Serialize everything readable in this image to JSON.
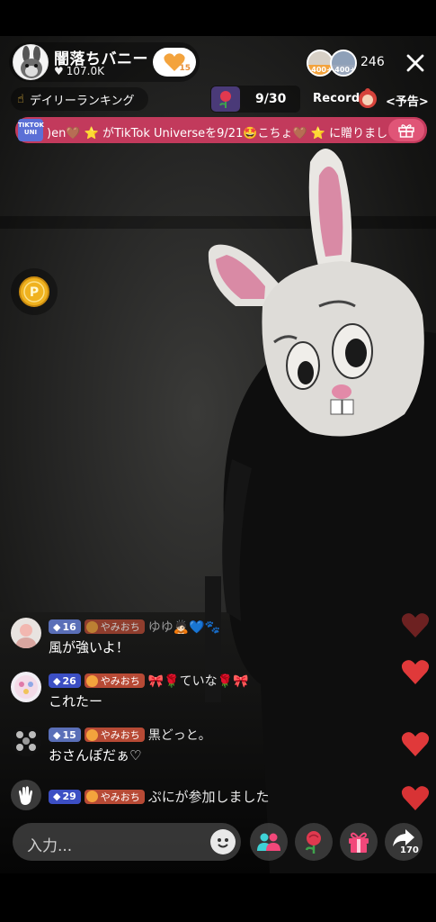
{
  "host": {
    "name": "闇落ちバニー",
    "likes": "107.0K",
    "follow_badge_count": "15"
  },
  "viewers": {
    "badge_1": "400+",
    "badge_2": "400+",
    "count": "246"
  },
  "ranking": {
    "label": "デイリーランキング"
  },
  "goal": {
    "progress": "9/30",
    "record_label": "Record",
    "preview_label": "<予告>"
  },
  "banner": {
    "logo_text": "TIKTOK UNI",
    "text": ")en🤎 ⭐ がTikTok Universeを9/21🤩こちょ🤎 ⭐ に贈りました"
  },
  "comments": [
    {
      "level": "16",
      "fan_club": "やみおち",
      "name": "ゆゆ🙇🏻💙🐾",
      "message": "風が強いよ！"
    },
    {
      "level": "26",
      "fan_club": "やみおち",
      "name": "🎀🌹ていな🌹🎀",
      "message": "これたー"
    },
    {
      "level": "15",
      "fan_club": "やみおち",
      "name": "黒どっと。",
      "message": "おさんぽだぁ♡"
    },
    {
      "level": "29",
      "fan_club": "やみおち",
      "name": "ぷにが参加しました",
      "message": ""
    }
  ],
  "bottom_bar": {
    "input_placeholder": "入力...",
    "share_count": "170"
  },
  "colors": {
    "banner": "#c23a5c",
    "level_badge": "#3c4fc4",
    "fan_badge": "#b74a35",
    "heart": "#e0393a"
  }
}
